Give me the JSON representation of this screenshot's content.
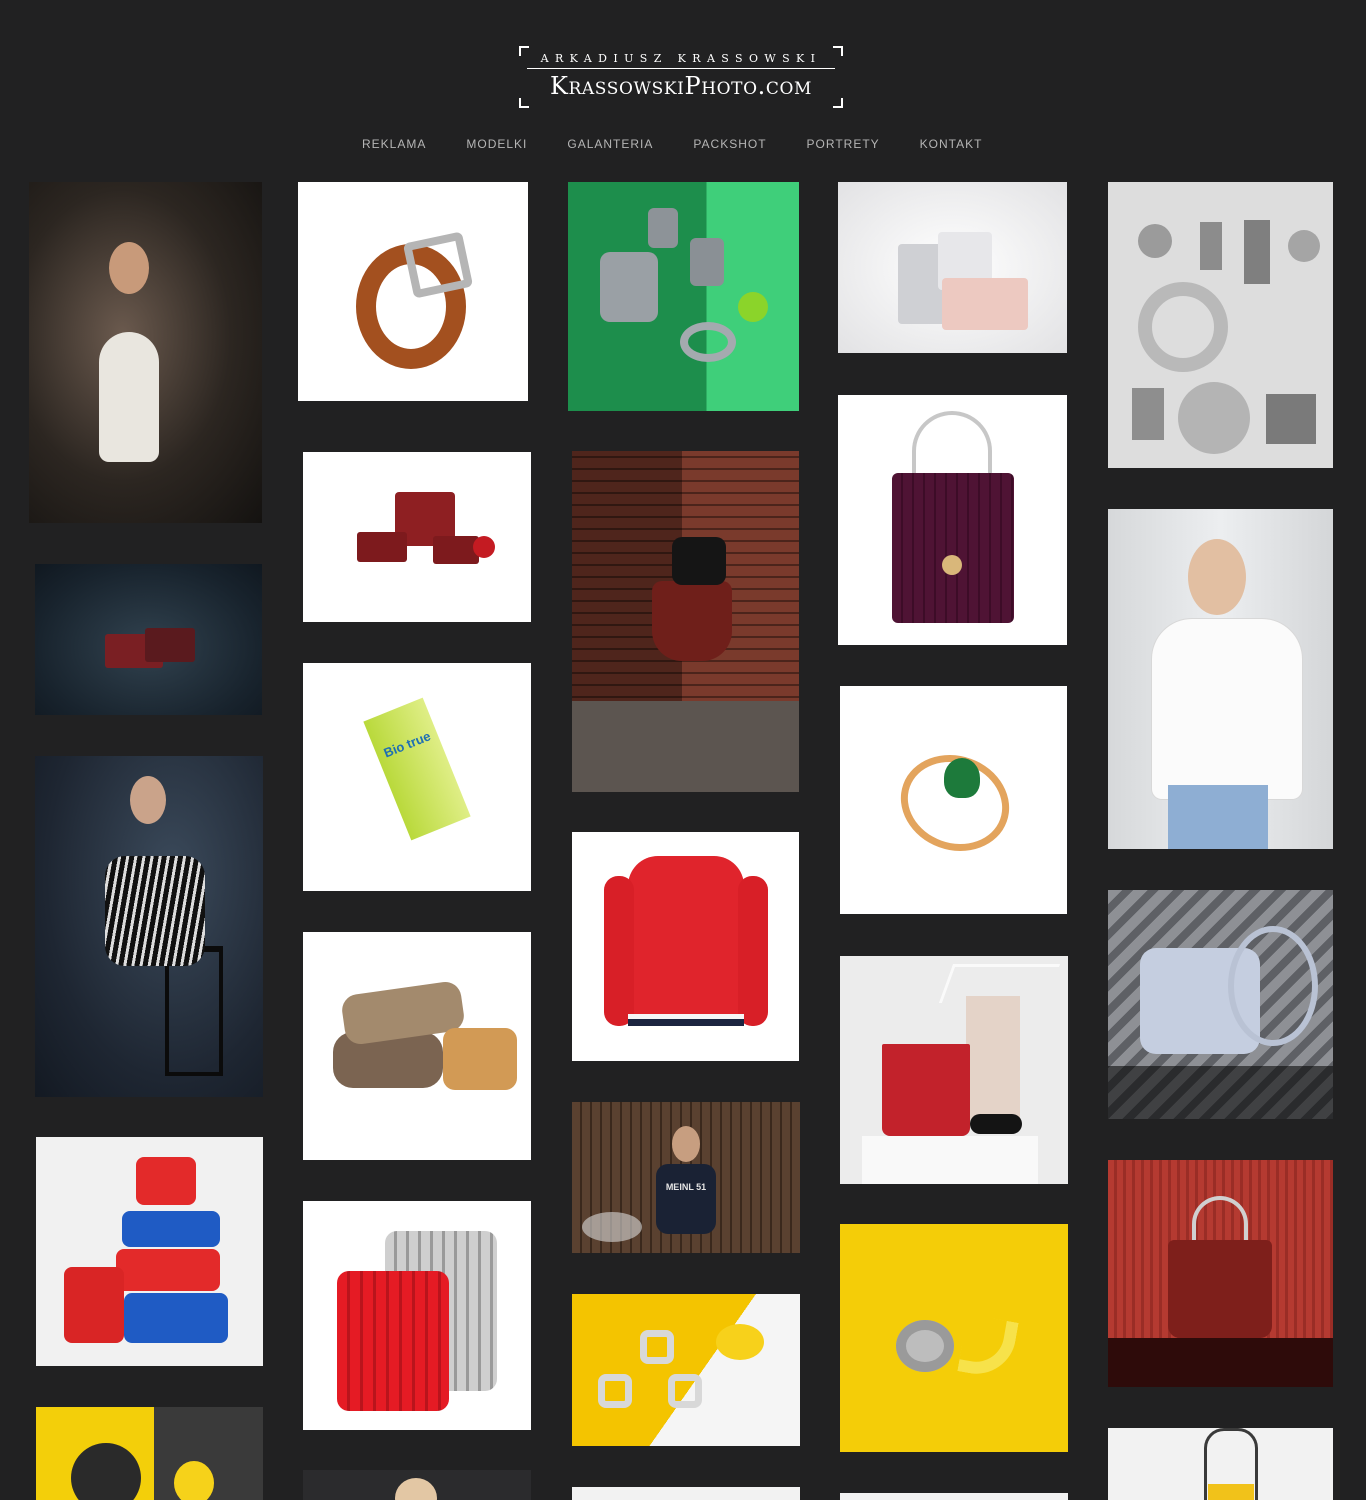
{
  "logo": {
    "top_line": "ARKADIUSZ KRASSOWSKI",
    "main_line": "KrassowskiPhoto.com"
  },
  "nav": {
    "items": [
      {
        "label": "REKLAMA"
      },
      {
        "label": "MODELKI"
      },
      {
        "label": "GALANTERIA"
      },
      {
        "label": "PACKSHOT"
      },
      {
        "label": "PORTRETY"
      },
      {
        "label": "KONTAKT"
      }
    ]
  },
  "gallery": {
    "photos": [
      {
        "name": "model-white-bodysuit-photo"
      },
      {
        "name": "brown-belt-photo"
      },
      {
        "name": "metal-parts-green-photo"
      },
      {
        "name": "handbags-grey-pink-photo"
      },
      {
        "name": "metal-parts-flatlay-photo"
      },
      {
        "name": "red-handbag-set-photo"
      },
      {
        "name": "model-brick-wall-photo"
      },
      {
        "name": "purple-handbag-photo"
      },
      {
        "name": "model-white-shirt-photo"
      },
      {
        "name": "red-wallets-photo"
      },
      {
        "name": "biotrue-box-photo",
        "brand_text": "Bio true"
      },
      {
        "name": "gold-ring-photo"
      },
      {
        "name": "model-striped-dress-photo"
      },
      {
        "name": "firewood-photo"
      },
      {
        "name": "red-sweater-photo"
      },
      {
        "name": "grey-crossbody-bag-photo"
      },
      {
        "name": "red-tote-hanger-photo"
      },
      {
        "name": "suitcase-stack-photo"
      },
      {
        "name": "drummer-photo",
        "shirt_text": "MEINL 51"
      },
      {
        "name": "red-handbag-red-bg-photo"
      },
      {
        "name": "red-silver-suitcases-photo"
      },
      {
        "name": "nuts-lemon-photo"
      },
      {
        "name": "spiral-part-banana-photo"
      },
      {
        "name": "flange-lemon-photo"
      },
      {
        "name": "portrait-partial-photo"
      },
      {
        "name": "bottom-tile-photo"
      },
      {
        "name": "bottom-tile-photo-2"
      },
      {
        "name": "yellow-bag-photo"
      }
    ]
  }
}
